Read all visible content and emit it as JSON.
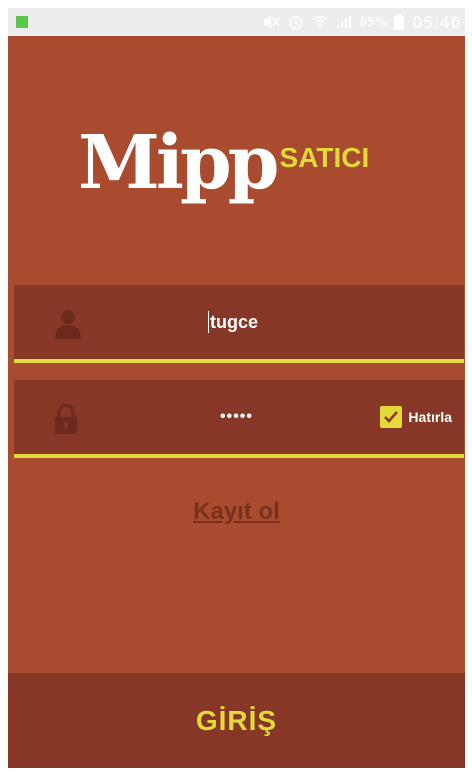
{
  "status_bar": {
    "battery_percent": "85%",
    "time": "05:46",
    "notification_color": "#5cc64b"
  },
  "logo": {
    "brand": "Mipp",
    "sub": "SATICI"
  },
  "login_form": {
    "username": {
      "icon": "user-icon",
      "value": "tugce"
    },
    "password": {
      "icon": "lock-icon",
      "masked_value": "•••••"
    },
    "remember_me": {
      "label": "Hatırla",
      "checked": true
    }
  },
  "register_link": "Kayıt ol",
  "login_button": "GİRİŞ",
  "colors": {
    "background": "#a84b2e",
    "field_background": "#873725",
    "accent": "#e4d93b"
  }
}
